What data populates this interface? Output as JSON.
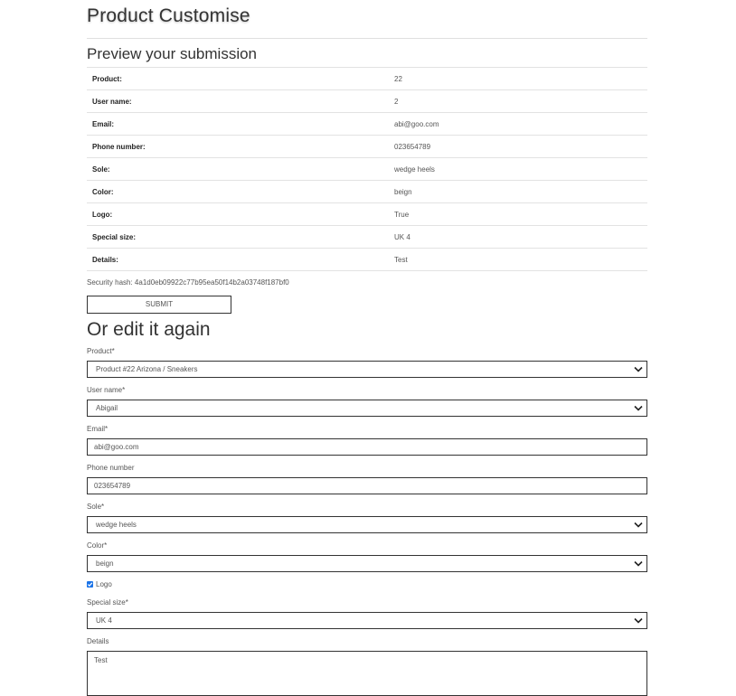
{
  "header": {
    "title": "Product Customise"
  },
  "preview": {
    "heading": "Preview your submission",
    "rows": [
      {
        "label": "Product:",
        "value": "22"
      },
      {
        "label": "User name:",
        "value": "2"
      },
      {
        "label": "Email:",
        "value": "abi@goo.com"
      },
      {
        "label": "Phone number:",
        "value": "023654789"
      },
      {
        "label": "Sole:",
        "value": "wedge heels"
      },
      {
        "label": "Color:",
        "value": "beign"
      },
      {
        "label": "Logo:",
        "value": "True"
      },
      {
        "label": "Special size:",
        "value": "UK 4"
      },
      {
        "label": "Details:",
        "value": "Test"
      }
    ],
    "security_hash": "Security hash: 4a1d0eb09922c77b95ea50f14b2a03748f187bf0",
    "submit_label": "SUBMIT"
  },
  "edit": {
    "heading": "Or edit it again",
    "product": {
      "label": "Product*",
      "value": "Product #22 Arizona / Sneakers",
      "icon": "chevron-down-icon"
    },
    "user_name": {
      "label": "User name*",
      "value": "Abigail",
      "icon": "chevron-down-icon"
    },
    "email": {
      "label": "Email*",
      "value": "abi@goo.com"
    },
    "phone": {
      "label": "Phone number",
      "value": "023654789"
    },
    "sole": {
      "label": "Sole*",
      "value": "wedge heels",
      "icon": "chevron-down-icon"
    },
    "color": {
      "label": "Color*",
      "value": "beign",
      "icon": "chevron-down-icon"
    },
    "logo": {
      "label": "Logo",
      "checked": true,
      "icon": "checkmark-icon"
    },
    "special_size": {
      "label": "Special size*",
      "value": "UK 4",
      "icon": "chevron-down-icon"
    },
    "details": {
      "label": "Details",
      "value": "Test"
    }
  },
  "colors": {
    "text": "#333333",
    "border": "#333333",
    "row_rule": "#e2e2e2",
    "checkbox": "#1a73e8"
  }
}
